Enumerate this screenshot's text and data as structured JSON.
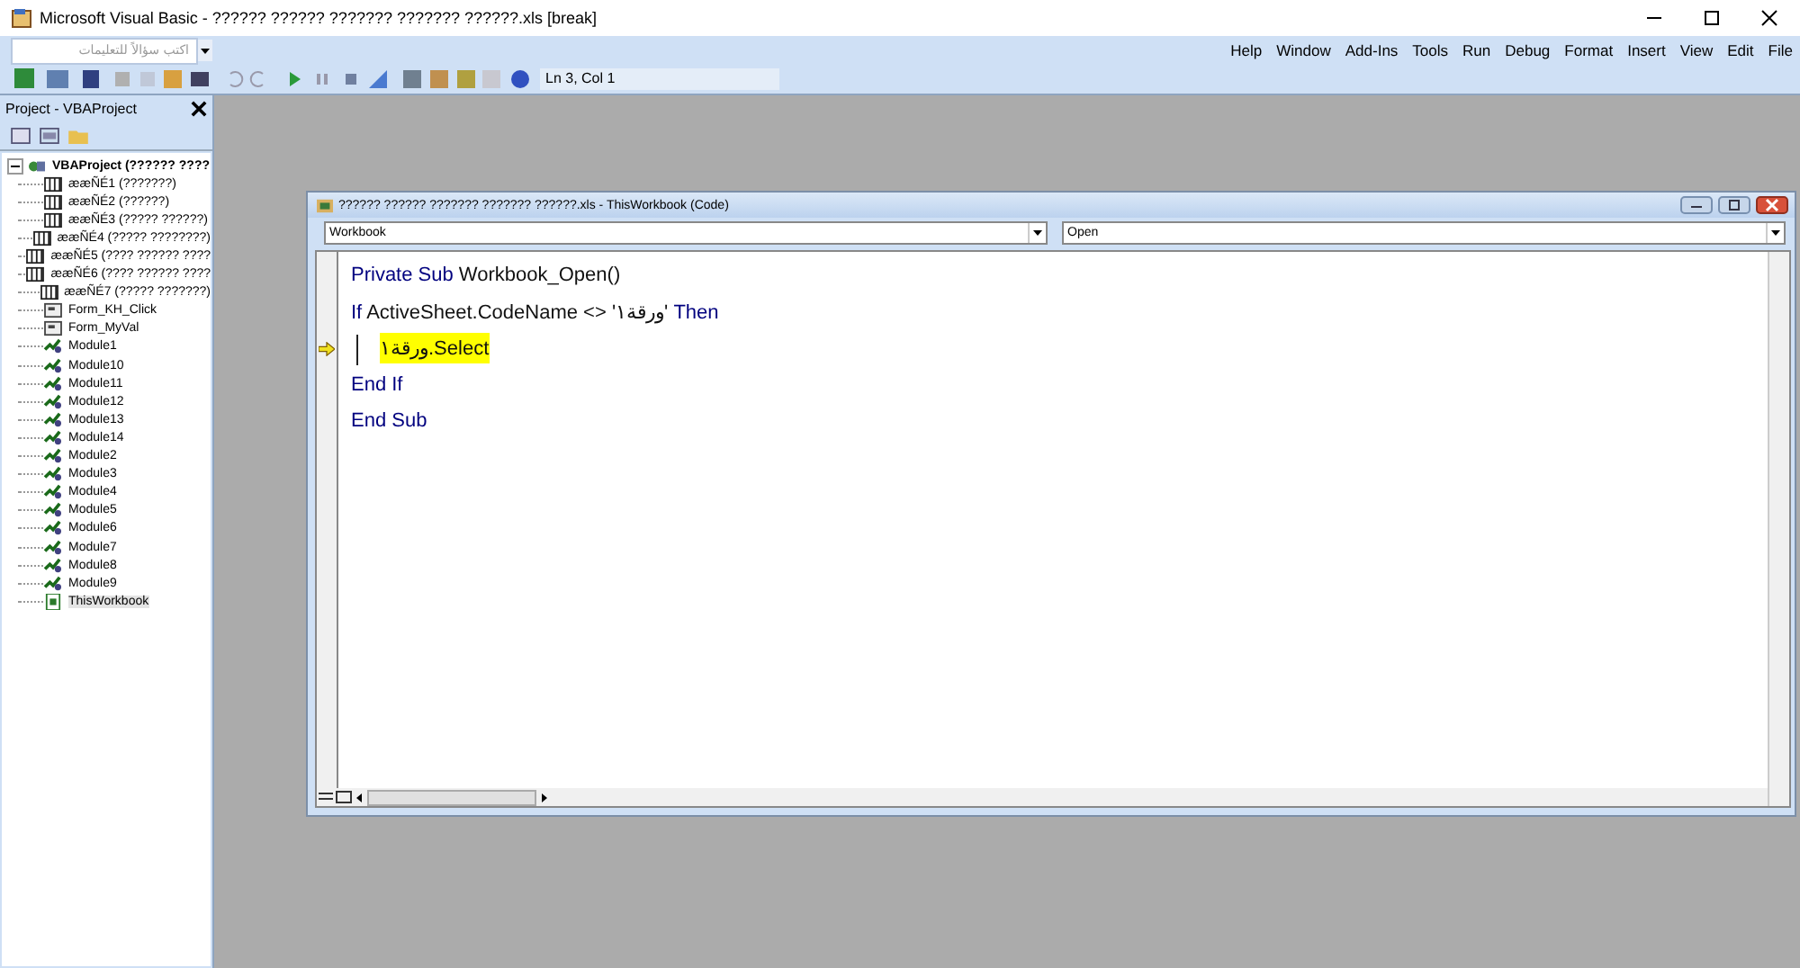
{
  "window": {
    "title": "Microsoft Visual Basic - ?????? ?????? ??????? ??????? ??????.xls [break]"
  },
  "question_box": {
    "placeholder": "اكتب سؤالاً للتعليمات"
  },
  "menu": [
    "Help",
    "Window",
    "Add-Ins",
    "Tools",
    "Run",
    "Debug",
    "Format",
    "Insert",
    "View",
    "Edit",
    "File"
  ],
  "toolbar": {
    "position": "Ln 3, Col 1"
  },
  "project_pane": {
    "title": "Project - VBAProject",
    "tree": [
      {
        "label": "VBAProject (?????? ????",
        "kind": "project",
        "expanded": true,
        "children": [
          {
            "label": "ææÑÉ1 (???????)",
            "kind": "sheet",
            "selected": false
          },
          {
            "label": "ææÑÉ2 (??????)",
            "kind": "sheet",
            "selected": false
          },
          {
            "label": "ææÑÉ3 (????? ??????)",
            "kind": "sheet",
            "selected": false
          },
          {
            "label": "ææÑÉ4 (????? ????????)",
            "kind": "sheet",
            "selected": false
          },
          {
            "label": "ææÑÉ5 (???? ?????? ????",
            "kind": "sheet",
            "selected": false
          },
          {
            "label": "ææÑÉ6 (???? ?????? ????",
            "kind": "sheet",
            "selected": false
          },
          {
            "label": "ææÑÉ7 (????? ???????)",
            "kind": "sheet",
            "selected": false
          },
          {
            "label": "Form_KH_Click",
            "kind": "form",
            "selected": false
          },
          {
            "label": "Form_MyVal",
            "kind": "form",
            "selected": false
          },
          {
            "label": "Module1",
            "kind": "module",
            "selected": false
          },
          {
            "label": "Module10",
            "kind": "module",
            "selected": false
          },
          {
            "label": "Module11",
            "kind": "module",
            "selected": false
          },
          {
            "label": "Module12",
            "kind": "module",
            "selected": false
          },
          {
            "label": "Module13",
            "kind": "module",
            "selected": false
          },
          {
            "label": "Module14",
            "kind": "module",
            "selected": false
          },
          {
            "label": "Module2",
            "kind": "module",
            "selected": false
          },
          {
            "label": "Module3",
            "kind": "module",
            "selected": false
          },
          {
            "label": "Module4",
            "kind": "module",
            "selected": false
          },
          {
            "label": "Module5",
            "kind": "module",
            "selected": false
          },
          {
            "label": "Module6",
            "kind": "module",
            "selected": false
          },
          {
            "label": "Module7",
            "kind": "module",
            "selected": false
          },
          {
            "label": "Module8",
            "kind": "module",
            "selected": false
          },
          {
            "label": "Module9",
            "kind": "module",
            "selected": false
          },
          {
            "label": "ThisWorkbook",
            "kind": "workbook",
            "selected": true
          }
        ]
      }
    ]
  },
  "code_window": {
    "title": "?????? ?????? ??????? ??????? ??????.xls - ThisWorkbook (Code)",
    "object_box": "Workbook",
    "procedure_box": "Open",
    "lines": [
      {
        "tokens": [
          {
            "kind": "keyword",
            "text": "Private Sub"
          },
          {
            "kind": "plain",
            "text": " Workbook_Open()"
          }
        ]
      },
      {
        "tokens": [
          {
            "kind": "keyword",
            "text": "If"
          },
          {
            "kind": "plain",
            "text": " ActiveSheet.CodeName <> "
          },
          {
            "kind": "plain",
            "text": "'ورقة١'"
          },
          {
            "kind": "keyword",
            "text": " Then"
          }
        ],
        "children": [
          {
            "tokens": [
              {
                "kind": "plain",
                "text": "ورقة١.Select"
              }
            ],
            "execution_point": true,
            "cursor": true
          }
        ]
      },
      {
        "tokens": [
          {
            "kind": "keyword",
            "text": "End If"
          }
        ]
      },
      {
        "tokens": [
          {
            "kind": "keyword",
            "text": "End Sub"
          }
        ]
      }
    ]
  }
}
